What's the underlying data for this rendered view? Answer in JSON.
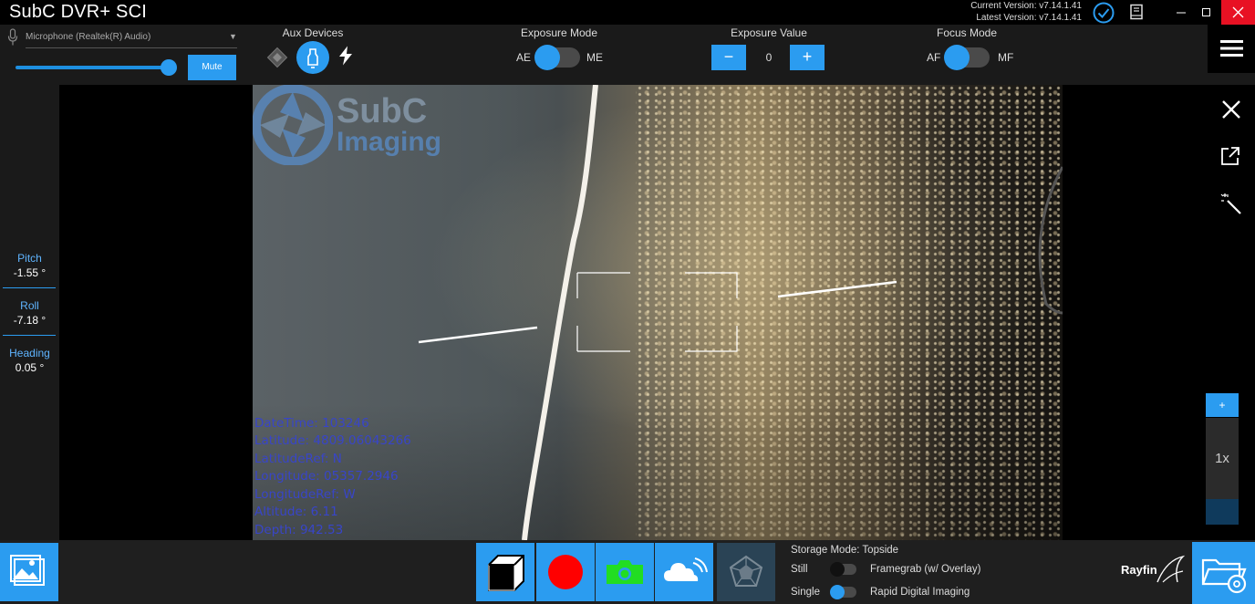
{
  "app": {
    "title": "SubC DVR+ SCI",
    "current_version": "Current Version: v7.14.1.41",
    "latest_version": "Latest Version: v7.14.1.41"
  },
  "audio": {
    "microphone": "Microphone (Realtek(R) Audio)",
    "volume_level": 0.95,
    "mute_label": "Mute"
  },
  "aux": {
    "label": "Aux Devices",
    "light_active": true
  },
  "exposure_mode": {
    "label": "Exposure Mode",
    "left": "AE",
    "right": "ME",
    "value": "AE"
  },
  "exposure_value": {
    "label": "Exposure Value",
    "minus": "−",
    "plus": "+",
    "value": "0"
  },
  "focus_mode": {
    "label": "Focus Mode",
    "left": "AF",
    "right": "MF",
    "value": "AF"
  },
  "attitude": [
    {
      "label": "Pitch",
      "value": "-1.55 °"
    },
    {
      "label": "Roll",
      "value": "-7.18 °"
    },
    {
      "label": "Heading",
      "value": "0.05 °"
    }
  ],
  "video": {
    "watermark_line1": "SubC",
    "watermark_line2": "Imaging",
    "overlay": [
      "DateTime: 103246",
      "Latitude: 4809.06043266",
      "LatitudeRef: N",
      "Longitude: 05357.2946",
      "LongitudeRef: W",
      "Altitude: 6.11",
      "Depth: 942.53"
    ]
  },
  "zoom": {
    "plus": "+",
    "level": "1x"
  },
  "storage": {
    "mode": "Storage Mode: Topside",
    "still_label": "Still",
    "single_label": "Single",
    "framegrab_label": "Framegrab (w/ Overlay)",
    "rdi_label": "Rapid Digital Imaging",
    "framegrab_on": false,
    "rdi_on": true
  },
  "brand": {
    "rayfin": "Rayfin"
  },
  "colors": {
    "accent": "#2b9cf0",
    "record": "#ff0000",
    "photo": "#22dd22",
    "overlay_text": "#3845c8"
  },
  "icons": [
    "microphone-icon",
    "check-circle-icon",
    "book-icon",
    "diamond-icon",
    "light-icon",
    "bolt-icon",
    "hamburger-icon",
    "close-icon",
    "popout-icon",
    "magic-wand-icon",
    "gallery-icon",
    "cube-icon",
    "record-icon",
    "camera-icon",
    "cloud-icon",
    "pentagon-icon",
    "folder-gear-icon"
  ]
}
